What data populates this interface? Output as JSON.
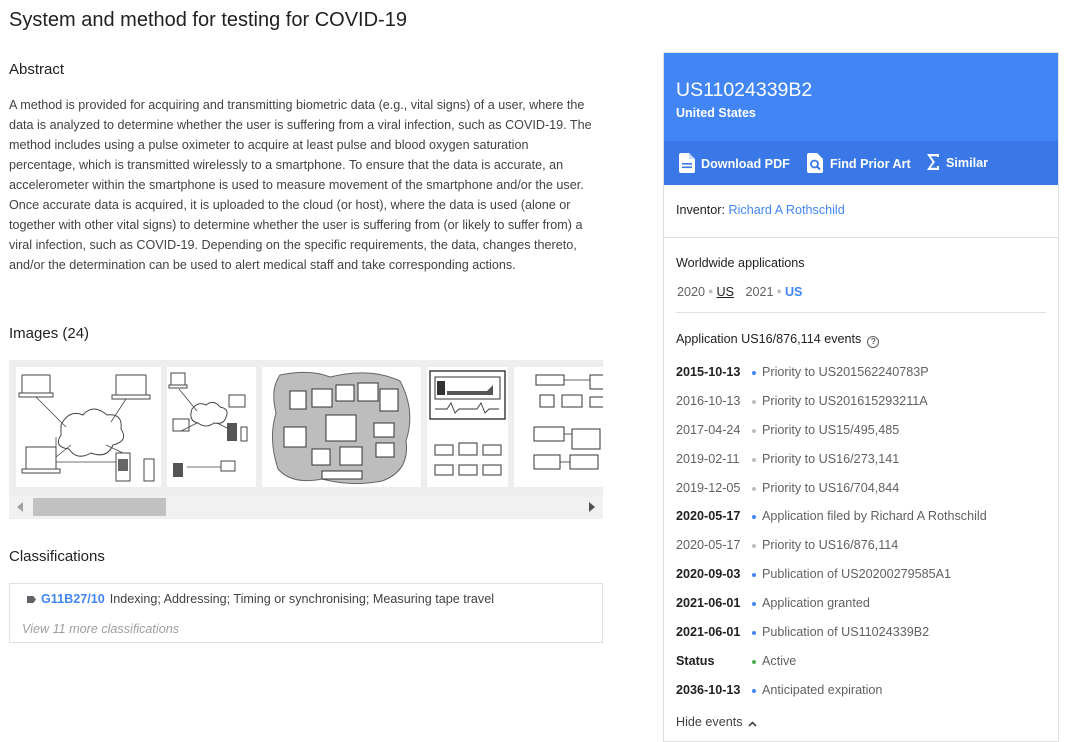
{
  "title": "System and method for testing for COVID-19",
  "abstract": {
    "heading": "Abstract",
    "text": "A method is provided for acquiring and transmitting biometric data (e.g., vital signs) of a user, where the data is analyzed to determine whether the user is suffering from a viral infection, such as COVID-19. The method includes using a pulse oximeter to acquire at least pulse and blood oxygen saturation percentage, which is transmitted wirelessly to a smartphone. To ensure that the data is accurate, an accelerometer within the smartphone is used to measure movement of the smartphone and/or the user. Once accurate data is acquired, it is uploaded to the cloud (or host), where the data is used (alone or together with other vital signs) to determine whether the user is suffering from (or likely to suffer from) a viral infection, such as COVID-19. Depending on the specific requirements, the data, changes thereto, and/or the determination can be used to alert medical staff and take corresponding actions."
  },
  "images": {
    "heading": "Images (24)"
  },
  "classifications": {
    "heading": "Classifications",
    "items": [
      {
        "code": "G11B27/10",
        "description": "Indexing; Addressing; Timing or synchronising; Measuring tape travel"
      }
    ],
    "view_more": "View 11 more classifications"
  },
  "panel": {
    "number": "US11024339B2",
    "country": "United States",
    "actions": {
      "pdf": "Download PDF",
      "prior_art": "Find Prior Art",
      "similar": "Similar"
    },
    "inventor_label": "Inventor: ",
    "inventor_name": "Richard A Rothschild",
    "worldwide": {
      "title": "Worldwide applications",
      "entries": [
        {
          "year": "2020",
          "country": "US"
        },
        {
          "year": "2021",
          "country": "US"
        }
      ]
    },
    "events_title": "Application US16/876,114 events",
    "events": [
      {
        "date": "2015-10-13",
        "text": "Priority to US201562240783P"
      },
      {
        "date": "2016-10-13",
        "text": "Priority to US201615293211A"
      },
      {
        "date": "2017-04-24",
        "text": "Priority to US15/495,485"
      },
      {
        "date": "2019-02-11",
        "text": "Priority to US16/273,141"
      },
      {
        "date": "2019-12-05",
        "text": "Priority to US16/704,844"
      },
      {
        "date": "2020-05-17",
        "text": "Application filed by Richard A Rothschild"
      },
      {
        "date": "2020-05-17",
        "text": "Priority to US16/876,114"
      },
      {
        "date": "2020-09-03",
        "text": "Publication of US20200279585A1"
      },
      {
        "date": "2021-06-01",
        "text": "Application granted"
      },
      {
        "date": "2021-06-01",
        "text": "Publication of US11024339B2"
      },
      {
        "date": "Status",
        "text": "Active"
      },
      {
        "date": "2036-10-13",
        "text": "Anticipated expiration"
      }
    ],
    "hide_events": "Hide events",
    "colors": {
      "header": "#4285f4",
      "actions_bar": "#3b78e7",
      "link": "#4285f4"
    }
  }
}
